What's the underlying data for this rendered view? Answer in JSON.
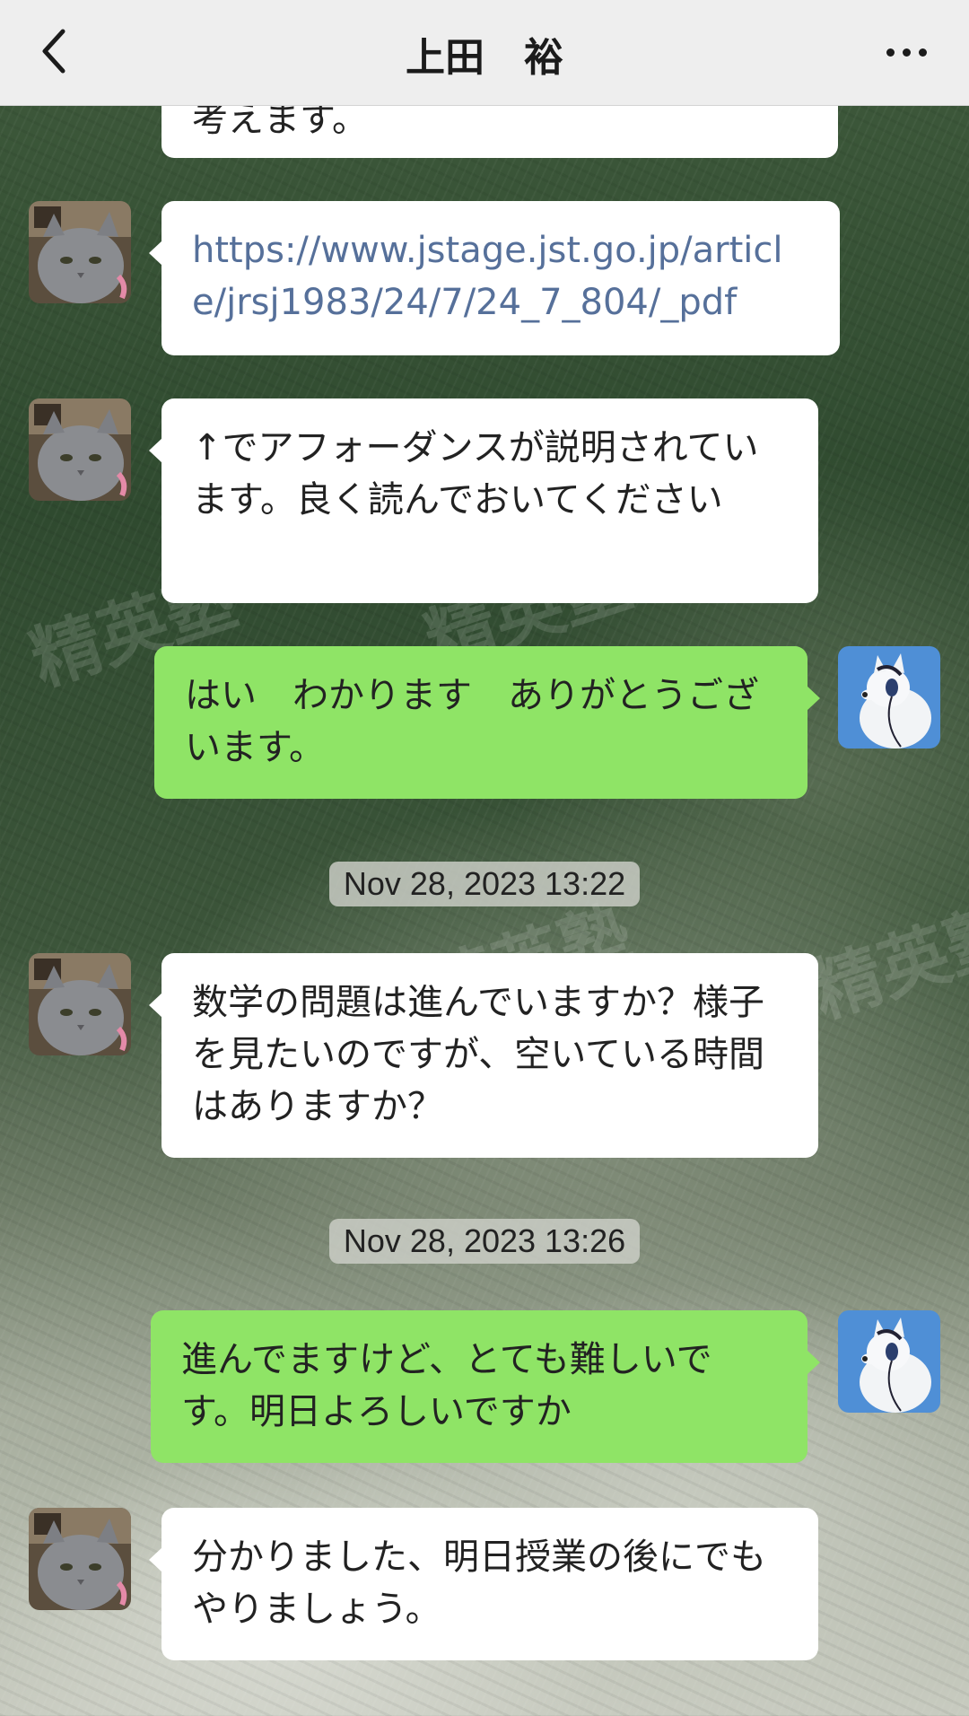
{
  "header": {
    "title": "上田　裕"
  },
  "messages": [
    {
      "id": "m0",
      "sender": "other",
      "text": "考えます。"
    },
    {
      "id": "m1",
      "sender": "other",
      "text": "https://www.jstage.jst.go.jp/article/jrsj1983/24/7/24_7_804/_pdf",
      "is_link": true
    },
    {
      "id": "m2",
      "sender": "other",
      "text": "↑でアフォーダンスが説明されています。良く読んでおいてください"
    },
    {
      "id": "m3",
      "sender": "me",
      "text": "はい　わかります　ありがとうございます。"
    },
    {
      "id": "m4",
      "sender": "other",
      "text": "数学の問題は進んでいますか？様子を見たいのですが、空いている時間はありますか？"
    },
    {
      "id": "m5",
      "sender": "me",
      "text": "進んでますけど、とても難しいです。明日よろしいですか"
    },
    {
      "id": "m6",
      "sender": "other",
      "text": "分かりました、明日授業の後にでもやりましょう。"
    }
  ],
  "timestamps": [
    "Nov 28, 2023 13:22",
    "Nov 28, 2023 13:26"
  ],
  "watermark": "精英塾",
  "colors": {
    "header_bg": "#eeeeee",
    "incoming_bubble": "#ffffff",
    "outgoing_bubble": "#8fe466",
    "link": "#56709a",
    "chat_bg": "#3f5a3c"
  },
  "icons": {
    "back": "chevron-left-icon",
    "more": "more-horizontal-icon",
    "other_avatar": "gray-cat-avatar",
    "my_avatar": "white-dog-headphones-avatar"
  }
}
